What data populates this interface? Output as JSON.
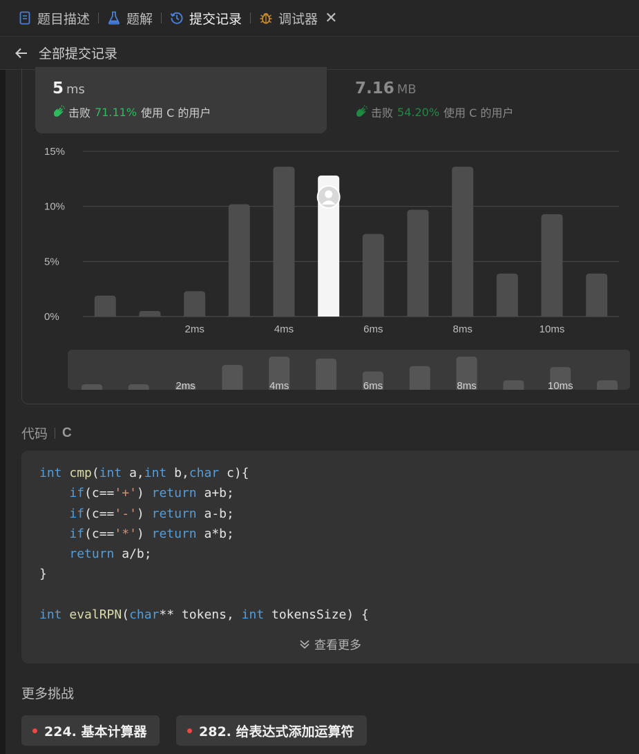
{
  "tabs": [
    {
      "label": "题目描述",
      "icon": "document-icon"
    },
    {
      "label": "题解",
      "icon": "flask-icon"
    },
    {
      "label": "提交记录",
      "icon": "history-icon",
      "active": true
    },
    {
      "label": "调试器",
      "icon": "bug-icon"
    }
  ],
  "subheader": {
    "title": "全部提交记录"
  },
  "stats": {
    "runtime": {
      "value": "5",
      "unit": "ms",
      "beat_prefix": "击败",
      "beat_pct": "71.11%",
      "beat_suffix": "使用 C 的用户"
    },
    "memory": {
      "value": "7.16",
      "unit": "MB",
      "beat_prefix": "击败",
      "beat_pct": "54.20%",
      "beat_suffix": "使用 C 的用户"
    }
  },
  "chart_data": {
    "type": "bar",
    "x": [
      0,
      1,
      2,
      3,
      4,
      5,
      6,
      7,
      8,
      9,
      10,
      11
    ],
    "values": [
      1.9,
      0.5,
      2.3,
      10.2,
      13.6,
      12.8,
      7.5,
      9.7,
      13.6,
      3.9,
      9.3,
      3.9
    ],
    "highlight_index": 5,
    "xtick_labels": [
      "",
      "",
      "2ms",
      "",
      "4ms",
      "",
      "6ms",
      "",
      "8ms",
      "",
      "10ms",
      ""
    ],
    "ytick_labels": [
      "0%",
      "5%",
      "10%",
      "15%"
    ],
    "ylim": [
      0,
      15
    ],
    "grid": true
  },
  "code": {
    "label": "代码",
    "language": "C",
    "lines": [
      [
        {
          "t": "int",
          "c": "kw"
        },
        {
          "t": " "
        },
        {
          "t": "cmp",
          "c": "fn"
        },
        {
          "t": "("
        },
        {
          "t": "int",
          "c": "kw"
        },
        {
          "t": " a,"
        },
        {
          "t": "int",
          "c": "kw"
        },
        {
          "t": " b,"
        },
        {
          "t": "char",
          "c": "kw"
        },
        {
          "t": " c){"
        }
      ],
      [
        {
          "t": "    "
        },
        {
          "t": "if",
          "c": "kw"
        },
        {
          "t": "(c=="
        },
        {
          "t": "'+'",
          "c": "str"
        },
        {
          "t": ") "
        },
        {
          "t": "return",
          "c": "kw"
        },
        {
          "t": " a+b;"
        }
      ],
      [
        {
          "t": "    "
        },
        {
          "t": "if",
          "c": "kw"
        },
        {
          "t": "(c=="
        },
        {
          "t": "'-'",
          "c": "str"
        },
        {
          "t": ") "
        },
        {
          "t": "return",
          "c": "kw"
        },
        {
          "t": " a-b;"
        }
      ],
      [
        {
          "t": "    "
        },
        {
          "t": "if",
          "c": "kw"
        },
        {
          "t": "(c=="
        },
        {
          "t": "'*'",
          "c": "str"
        },
        {
          "t": ") "
        },
        {
          "t": "return",
          "c": "kw"
        },
        {
          "t": " a*b;"
        }
      ],
      [
        {
          "t": "    "
        },
        {
          "t": "return",
          "c": "kw"
        },
        {
          "t": " a/b;"
        }
      ],
      [
        {
          "t": "}"
        }
      ],
      [
        {
          "t": ""
        }
      ],
      [
        {
          "t": "int",
          "c": "kw"
        },
        {
          "t": " "
        },
        {
          "t": "evalRPN",
          "c": "fn"
        },
        {
          "t": "("
        },
        {
          "t": "char",
          "c": "kw"
        },
        {
          "t": "** tokens, "
        },
        {
          "t": "int",
          "c": "kw"
        },
        {
          "t": " tokensSize) {"
        }
      ]
    ],
    "more_label": "查看更多"
  },
  "more_challenges": {
    "title": "更多挑战",
    "items": [
      "224. 基本计算器",
      "282. 给表达式添加运算符"
    ]
  },
  "colors": {
    "accent_green": "#2cbb5d",
    "dot_red": "#ef4743",
    "keyword": "#569cd6",
    "function": "#dcdcaa",
    "string": "#ce9178"
  }
}
